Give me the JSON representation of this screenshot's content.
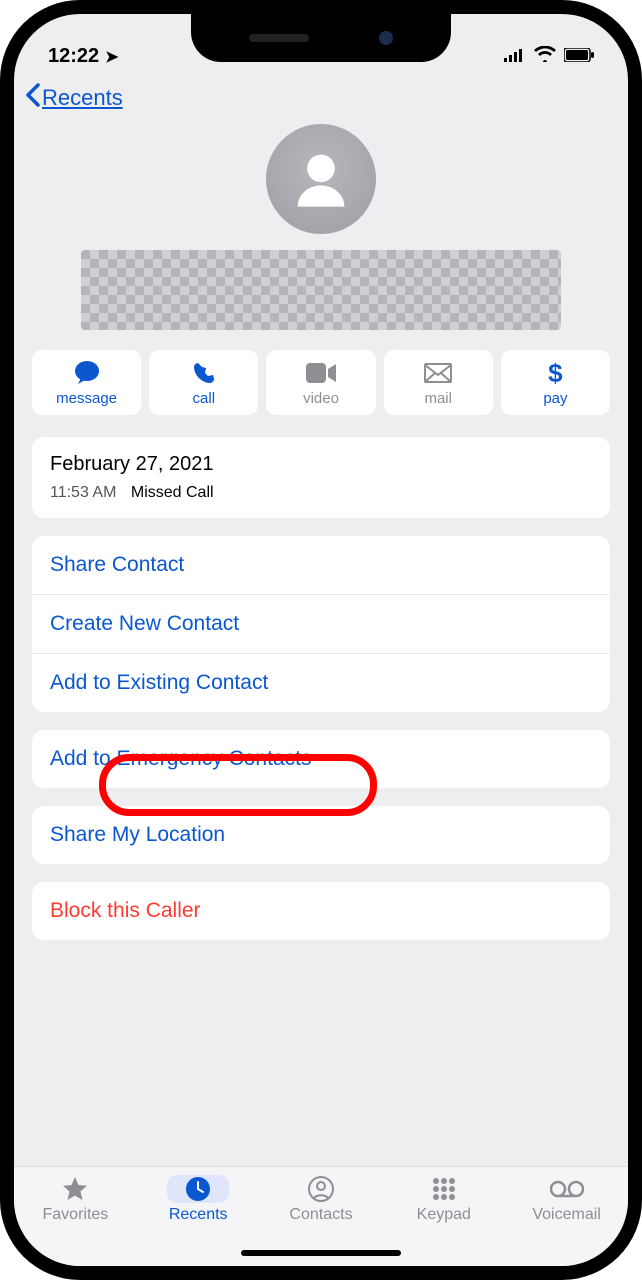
{
  "status": {
    "time": "12:22"
  },
  "nav": {
    "back": "Recents"
  },
  "quick": {
    "message": "message",
    "call": "call",
    "video": "video",
    "mail": "mail",
    "pay": "pay"
  },
  "history": {
    "date": "February 27, 2021",
    "time": "11:53 AM",
    "event": "Missed Call"
  },
  "actions": {
    "share_contact": "Share Contact",
    "create_new": "Create New Contact",
    "add_existing": "Add to Existing Contact",
    "add_emergency": "Add to Emergency Contacts",
    "share_location": "Share My Location",
    "block": "Block this Caller"
  },
  "tabs": {
    "favorites": "Favorites",
    "recents": "Recents",
    "contacts": "Contacts",
    "keypad": "Keypad",
    "voicemail": "Voicemail"
  }
}
